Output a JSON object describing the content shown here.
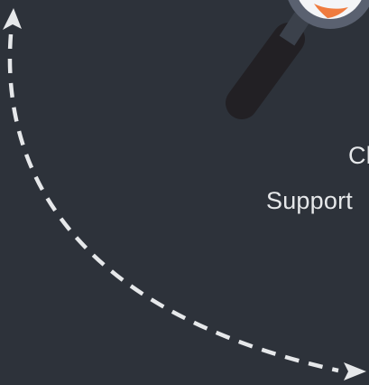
{
  "caption": {
    "line1": "Cl",
    "line2": "Support"
  },
  "icons": {
    "magnifier": "magnifying-glass-icon",
    "arrow": "dashed-curved-arrow-icon"
  },
  "colors": {
    "background": "#2d323a",
    "arrow": "#e6e8ea",
    "handle": "#222024",
    "lens_ring": "#5a6170",
    "lens_fill": "#f4f5f7",
    "accent": "#ef7b3e",
    "text": "#e6e8ea"
  }
}
